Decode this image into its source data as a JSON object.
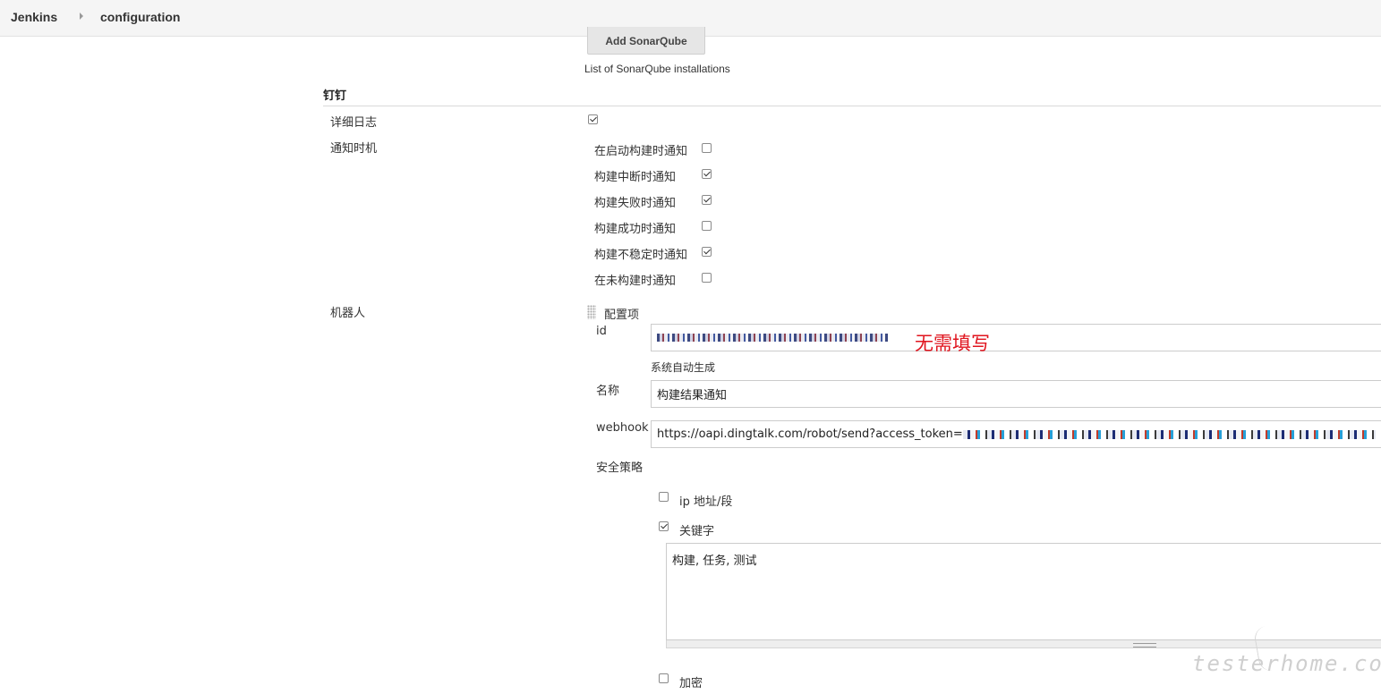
{
  "breadcrumb": {
    "home": "Jenkins",
    "current": "configuration"
  },
  "sonarqube": {
    "add_button": "Add SonarQube",
    "help": "List of SonarQube installations"
  },
  "dingtalk": {
    "section_title": "钉钉",
    "verbose_log": {
      "label": "详细日志",
      "checked": true
    },
    "notify_timing": {
      "label": "通知时机",
      "options": [
        {
          "label": "在启动构建时通知",
          "checked": false
        },
        {
          "label": "构建中断时通知",
          "checked": true
        },
        {
          "label": "构建失败时通知",
          "checked": true
        },
        {
          "label": "构建成功时通知",
          "checked": false
        },
        {
          "label": "构建不稳定时通知",
          "checked": true
        },
        {
          "label": "在未构建时通知",
          "checked": false
        }
      ]
    },
    "robot": {
      "label": "机器人",
      "config_item": "配置项",
      "id_label": "id",
      "id_annotation": "无需填写",
      "id_help": "系统自动生成",
      "name_label": "名称",
      "name_value": "构建结果通知",
      "webhook_label": "webhook",
      "webhook_value": "https://oapi.dingtalk.com/robot/send?access_token=",
      "security_label": "安全策略",
      "ip_option": {
        "label": "ip 地址/段",
        "checked": false
      },
      "keyword_option": {
        "label": "关键字",
        "checked": true
      },
      "keywords_value": "构建, 任务, 测试",
      "encrypt_option": {
        "label": "加密",
        "checked": false
      }
    }
  },
  "watermark": "testerhome.com",
  "colors": {
    "annotation": "#e0141e",
    "topbar": "#f5f5f5"
  }
}
